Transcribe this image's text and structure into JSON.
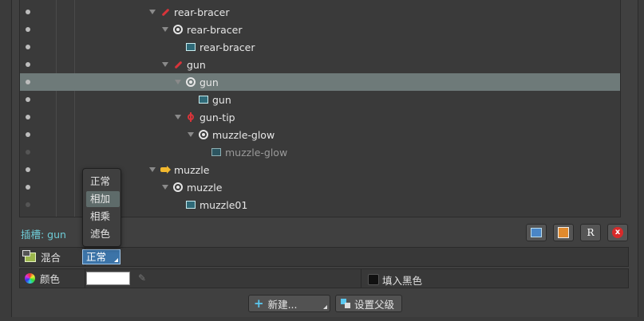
{
  "tree": {
    "rows": [
      {
        "label": "rear-bracer",
        "icon": "bone-icon",
        "indent": 0,
        "arrow": true,
        "selected": false,
        "dim": false,
        "eye_dim": false
      },
      {
        "label": "rear-bracer",
        "icon": "slot-icon",
        "indent": 1,
        "arrow": true,
        "selected": false,
        "dim": false,
        "eye_dim": false
      },
      {
        "label": "rear-bracer",
        "icon": "attachment-icon",
        "indent": 2,
        "arrow": false,
        "selected": false,
        "dim": false,
        "eye_dim": false
      },
      {
        "label": "gun",
        "icon": "bone-icon",
        "indent": 1,
        "arrow": true,
        "selected": false,
        "dim": false,
        "eye_dim": false
      },
      {
        "label": "gun",
        "icon": "slot-icon",
        "indent": 2,
        "arrow": true,
        "selected": true,
        "dim": false,
        "eye_dim": false
      },
      {
        "label": "gun",
        "icon": "attachment-icon",
        "indent": 3,
        "arrow": false,
        "selected": false,
        "dim": false,
        "eye_dim": false
      },
      {
        "label": "gun-tip",
        "icon": "target-icon",
        "indent": 2,
        "arrow": true,
        "selected": false,
        "dim": false,
        "eye_dim": false
      },
      {
        "label": "muzzle-glow",
        "icon": "slot-icon",
        "indent": 3,
        "arrow": true,
        "selected": false,
        "dim": false,
        "eye_dim": false
      },
      {
        "label": "muzzle-glow",
        "icon": "attachment-icon",
        "indent": 4,
        "arrow": false,
        "selected": false,
        "dim": true,
        "eye_dim": true
      },
      {
        "label": "muzzle",
        "icon": "path-icon",
        "indent": 0,
        "arrow": true,
        "selected": false,
        "dim": false,
        "eye_dim": false
      },
      {
        "label": "muzzle",
        "icon": "slot-icon",
        "indent": 1,
        "arrow": true,
        "selected": false,
        "dim": false,
        "eye_dim": false
      },
      {
        "label": "muzzle01",
        "icon": "attachment-icon",
        "indent": 2,
        "arrow": false,
        "selected": false,
        "dim": false,
        "eye_dim": true
      }
    ]
  },
  "slot_label": "插槽: gun",
  "toolbar_icons": [
    "duplicate-icon",
    "paste-icon",
    "rename-icon",
    "delete-icon"
  ],
  "rename_glyph": "R",
  "delete_glyph": "x",
  "blend": {
    "label": "混合",
    "value": "正常",
    "options": [
      "正常",
      "相加",
      "相乘",
      "滤色"
    ],
    "highlighted": "相加"
  },
  "color": {
    "label": "颜色",
    "value": "#ffffff",
    "fill_black_label": "填入黑色"
  },
  "buttons": {
    "new_label": "新建...",
    "set_parent_label": "设置父级"
  }
}
